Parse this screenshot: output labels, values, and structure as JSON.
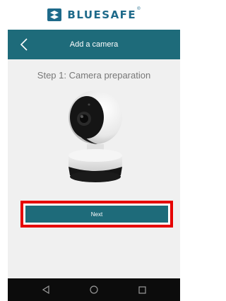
{
  "brand": {
    "name": "BLUESAFE",
    "mark": "®",
    "color": "#1e6a8a"
  },
  "app_bar": {
    "title": "Add a camera",
    "color": "#1e6b7a"
  },
  "step": {
    "title": "Step 1: Camera preparation"
  },
  "actions": {
    "next_label": "Next",
    "highlight_color": "#e60000"
  },
  "icons": {
    "brand": "bluesafe-logo-icon",
    "back": "chevron-left-icon",
    "camera": "ip-camera-illustration",
    "nav_back": "triangle-back-icon",
    "nav_home": "circle-home-icon",
    "nav_recents": "square-recents-icon"
  }
}
